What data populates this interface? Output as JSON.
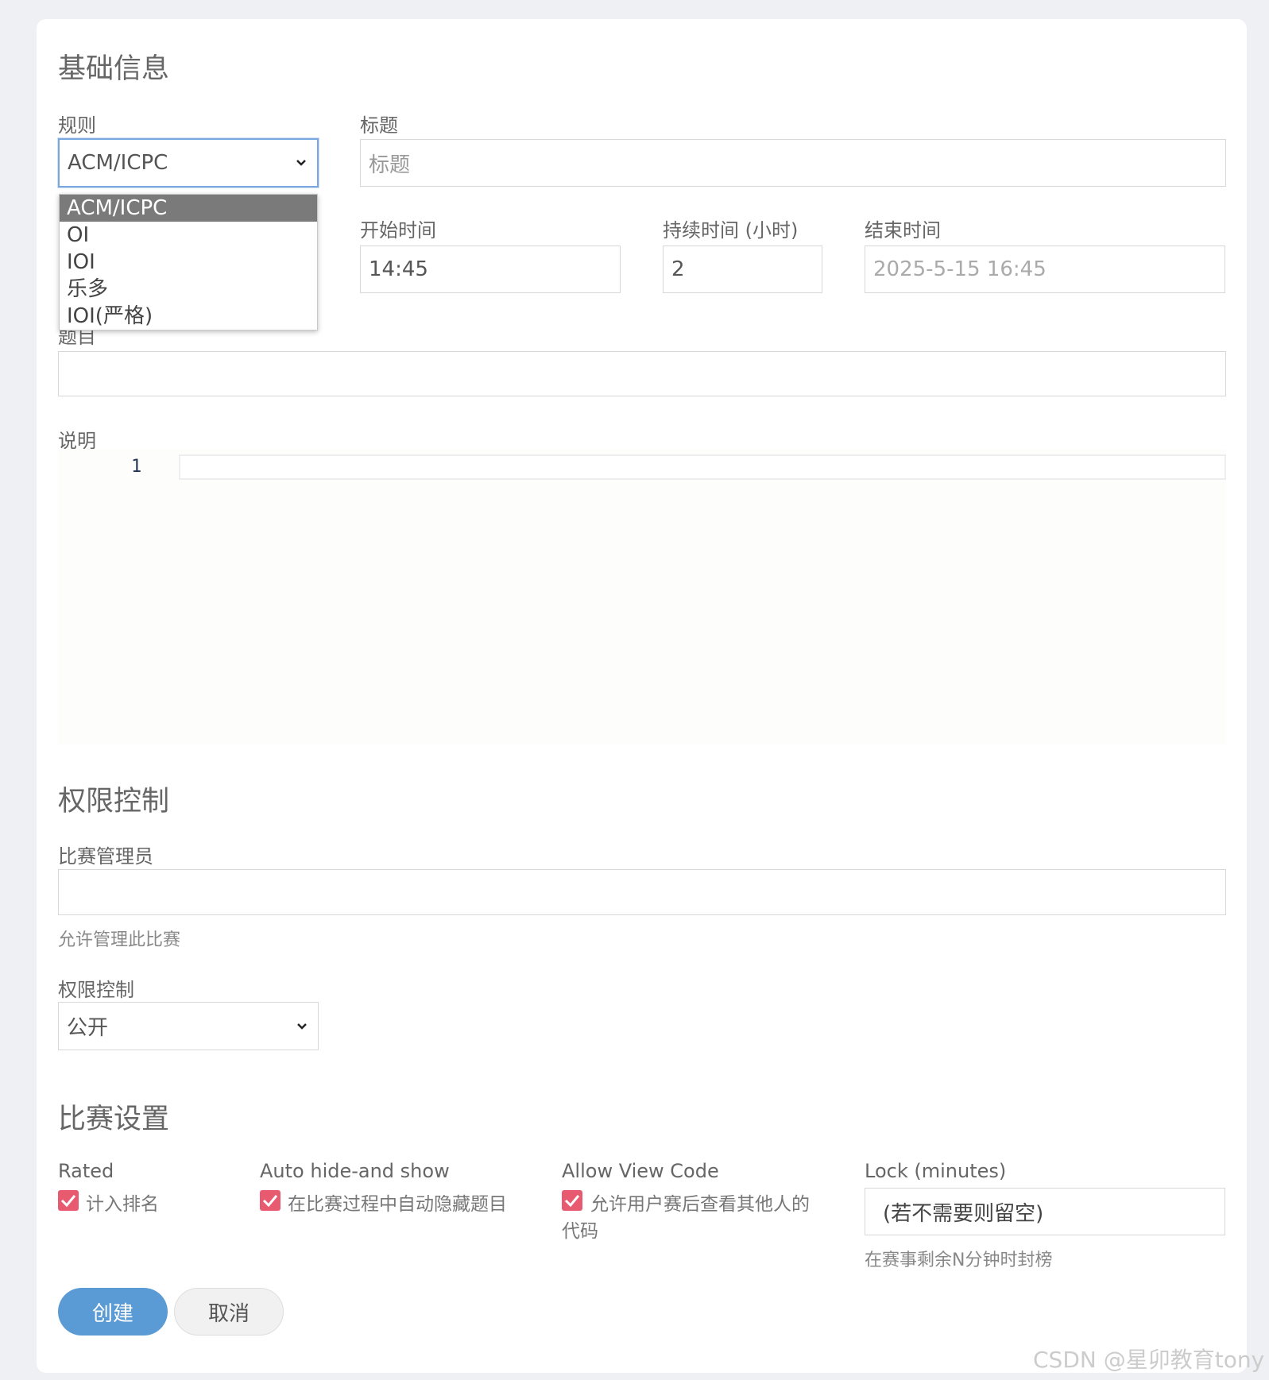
{
  "basic": {
    "section_title": "基础信息",
    "rule_label": "规则",
    "rule_value": "ACM/ICPC",
    "rule_options": [
      "ACM/ICPC",
      "OI",
      "IOI",
      "乐多",
      "IOI(严格)"
    ],
    "title_label": "标题",
    "title_placeholder": "标题",
    "start_label": "开始时间",
    "start_value": "14:45",
    "duration_label": "持续时间 (小时)",
    "duration_value": "2",
    "end_label": "结束时间",
    "end_placeholder": "2025-5-15 16:45",
    "problems_label": "题目",
    "desc_label": "说明",
    "editor_line": "1"
  },
  "permission": {
    "section_title": "权限控制",
    "admins_label": "比赛管理员",
    "admins_hint": "允许管理此比赛",
    "access_label": "权限控制",
    "access_value": "公开"
  },
  "settings": {
    "section_title": "比赛设置",
    "rated_label": "Rated",
    "rated_text": "计入排名",
    "autohide_label": "Auto hide-and show",
    "autohide_text": "在比赛过程中自动隐藏题目",
    "allowview_label": "Allow View Code",
    "allowview_text_1": "允许用户赛后查看其他人的",
    "allowview_text_2": "代码",
    "lock_label": "Lock (minutes)",
    "lock_placeholder": "(若不需要则留空)",
    "lock_hint": "在赛事剩余N分钟时封榜"
  },
  "actions": {
    "create": "创建",
    "cancel": "取消"
  },
  "watermark": "CSDN @星卯教育tony",
  "colors": {
    "primary": "#5b9bd5",
    "checkbox": "#e85a6f"
  }
}
